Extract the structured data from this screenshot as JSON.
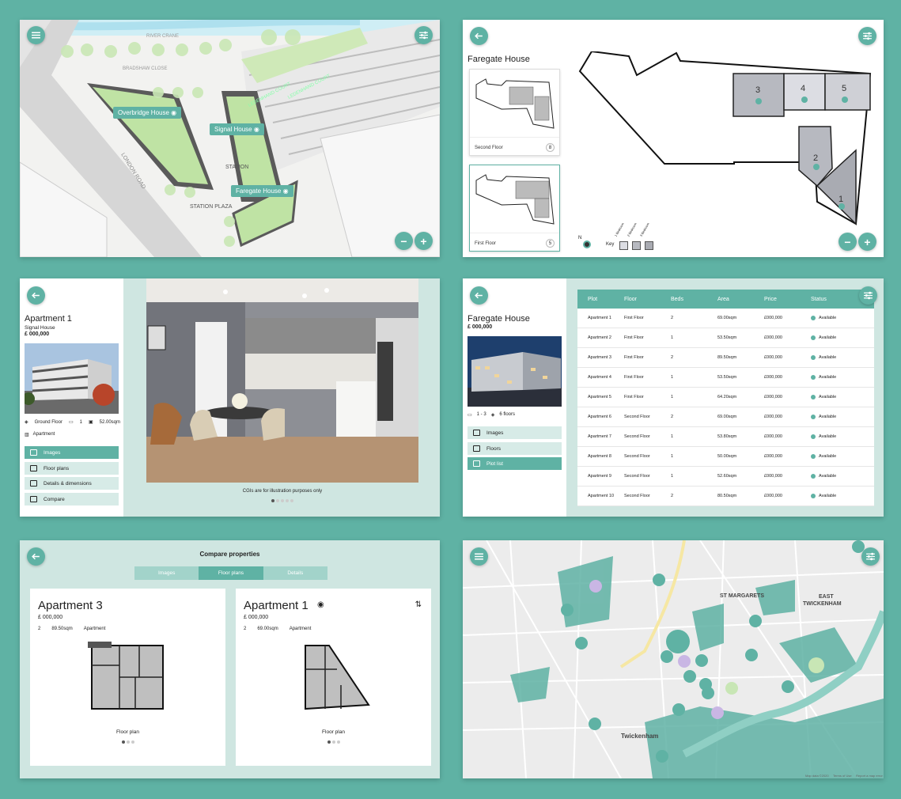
{
  "site_map": {
    "labels": {
      "river": "RIVER CRANE",
      "close": "BRADSHAW CLOSE",
      "road": "LONDON ROAD",
      "station": "STATION",
      "plaza": "STATION PLAZA",
      "court1": "LEDENHAND COURT",
      "court2": "LEDENHAND COURT"
    },
    "buildings": [
      {
        "name": "Overbridge House"
      },
      {
        "name": "Signal House"
      },
      {
        "name": "Faregate House"
      }
    ],
    "zoom_out": "−",
    "zoom_in": "+"
  },
  "floor_view": {
    "title": "Faregate House",
    "floors": [
      {
        "label": "Second Floor",
        "count": "8"
      },
      {
        "label": "First Floor",
        "count": "5"
      }
    ],
    "units": [
      "3",
      "4",
      "5",
      "2",
      "1"
    ],
    "key_label": "Key",
    "key_items": [
      "1 Bedroom",
      "2 Bedroom",
      "3 Bedroom"
    ],
    "compass": "N",
    "zoom_out": "−",
    "zoom_in": "+"
  },
  "apartment": {
    "title": "Apartment 1",
    "building": "Signal House",
    "price": "£ 000,000",
    "floor": "Ground Floor",
    "beds": "1",
    "area": "52.00sqm",
    "type": "Apartment",
    "menu": [
      "Images",
      "Floor plans",
      "Details & dimensions",
      "Compare"
    ],
    "caption": "CGIs are for illustration purposes only"
  },
  "plot_list": {
    "title": "Faregate House",
    "price": "£ 000,000",
    "beds": "1 - 3",
    "floors": "6 floors",
    "menu": [
      "Images",
      "Floors",
      "Plot list"
    ],
    "columns": [
      "Plot",
      "Floor",
      "Beds",
      "Area",
      "Price",
      "Status"
    ],
    "rows": [
      [
        "Apartment 1",
        "First Floor",
        "2",
        "69.00sqm",
        "£000,000",
        "Available"
      ],
      [
        "Apartment 2",
        "First Floor",
        "1",
        "53.50sqm",
        "£000,000",
        "Available"
      ],
      [
        "Apartment 3",
        "First Floor",
        "2",
        "89.50sqm",
        "£000,000",
        "Available"
      ],
      [
        "Apartment 4",
        "First Floor",
        "1",
        "53.50sqm",
        "£000,000",
        "Available"
      ],
      [
        "Apartment 5",
        "First Floor",
        "1",
        "64.20sqm",
        "£000,000",
        "Available"
      ],
      [
        "Apartment 6",
        "Second Floor",
        "2",
        "69.00sqm",
        "£000,000",
        "Available"
      ],
      [
        "Apartment 7",
        "Second Floor",
        "1",
        "53.80sqm",
        "£000,000",
        "Available"
      ],
      [
        "Apartment 8",
        "Second Floor",
        "1",
        "50.00sqm",
        "£000,000",
        "Available"
      ],
      [
        "Apartment 9",
        "Second Floor",
        "1",
        "52.60sqm",
        "£000,000",
        "Available"
      ],
      [
        "Apartment 10",
        "Second Floor",
        "2",
        "80.50sqm",
        "£000,000",
        "Available"
      ]
    ]
  },
  "compare": {
    "title": "Compare properties",
    "tabs": [
      "Images",
      "Floor plans",
      "Details"
    ],
    "cards": [
      {
        "title": "Apartment 3",
        "price": "£ 000,000",
        "beds": "2",
        "area": "89.50sqm",
        "type": "Apartment",
        "caption": "Floor plan"
      },
      {
        "title": "Apartment 1",
        "price": "£ 000,000",
        "beds": "2",
        "area": "69.00sqm",
        "type": "Apartment",
        "caption": "Floor plan"
      }
    ]
  },
  "area_map": {
    "places": {
      "st_margarets": "ST MARGARETS",
      "east": "EAST",
      "twickenham_east": "TWICKENHAM",
      "twickenham": "Twickenham"
    },
    "footer": [
      "Map data ©2020",
      "Terms of Use",
      "Report a map error"
    ],
    "accent": "#5fb2a4",
    "amenity_color": "#c9b6e4"
  }
}
